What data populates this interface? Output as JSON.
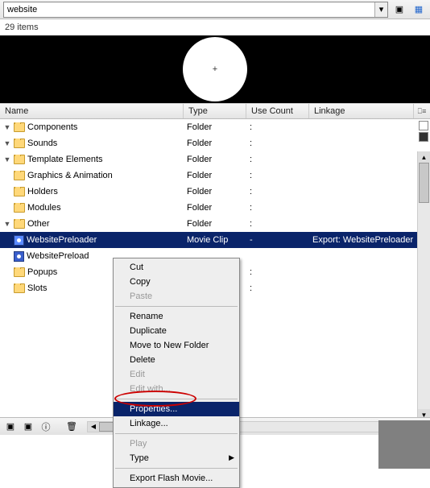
{
  "toolbar": {
    "search_value": "website"
  },
  "status": {
    "count_label": "29 items"
  },
  "preview": {
    "symbol": "+"
  },
  "columns": {
    "name": "Name",
    "type": "Type",
    "use": "Use Count",
    "linkage": "Linkage"
  },
  "rows": [
    {
      "indent": 1,
      "arrow": "▼",
      "icon": "folder",
      "name": "Components",
      "type": "Folder",
      "use": ":",
      "link": ""
    },
    {
      "indent": 1,
      "arrow": "▼",
      "icon": "folder",
      "name": "Sounds",
      "type": "Folder",
      "use": ":",
      "link": ""
    },
    {
      "indent": 1,
      "arrow": "▼",
      "icon": "folder",
      "name": "Template Elements",
      "type": "Folder",
      "use": ":",
      "link": ""
    },
    {
      "indent": 2,
      "arrow": "",
      "icon": "folder",
      "name": "Graphics & Animation",
      "type": "Folder",
      "use": ":",
      "link": ""
    },
    {
      "indent": 2,
      "arrow": "",
      "icon": "folder",
      "name": "Holders",
      "type": "Folder",
      "use": ":",
      "link": ""
    },
    {
      "indent": 2,
      "arrow": "",
      "icon": "folder",
      "name": "Modules",
      "type": "Folder",
      "use": ":",
      "link": ""
    },
    {
      "indent": 2,
      "arrow": "▼",
      "icon": "folder",
      "name": "Other",
      "type": "Folder",
      "use": ":",
      "link": ""
    },
    {
      "indent": 3,
      "arrow": "",
      "icon": "mc",
      "name": "WebsitePreloader",
      "type": "Movie Clip",
      "use": "-",
      "link": "Export: WebsitePreloader",
      "selected": true
    },
    {
      "indent": 3,
      "arrow": "",
      "icon": "mc",
      "name": "WebsitePreload",
      "type": "",
      "use": "",
      "link": ""
    },
    {
      "indent": 2,
      "arrow": "",
      "icon": "folder",
      "name": "Popups",
      "type": "Folder",
      "use": ":",
      "link": ""
    },
    {
      "indent": 2,
      "arrow": "",
      "icon": "folder",
      "name": "Slots",
      "type": "Folder",
      "use": ":",
      "link": ""
    }
  ],
  "context_menu": {
    "cut": "Cut",
    "copy": "Copy",
    "paste": "Paste",
    "rename": "Rename",
    "duplicate": "Duplicate",
    "move": "Move to New Folder",
    "delete": "Delete",
    "edit": "Edit",
    "edit_with": "Edit with...",
    "properties": "Properties...",
    "linkage": "Linkage...",
    "play": "Play",
    "type": "Type",
    "export": "Export Flash Movie..."
  }
}
